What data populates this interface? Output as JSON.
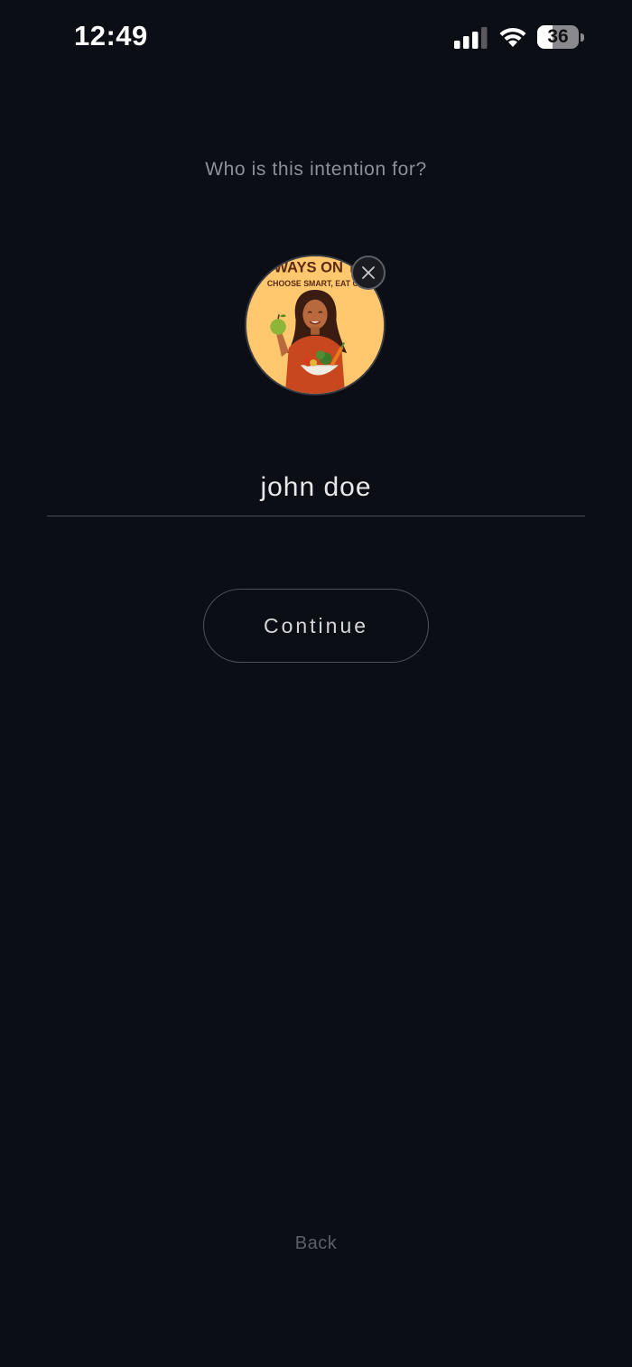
{
  "status_bar": {
    "time": "12:49",
    "battery_level": "36",
    "battery_fraction": 0.36,
    "signal_bars": 3,
    "signal_icon": "cellular-signal-icon",
    "wifi_icon": "wifi-icon",
    "battery_icon": "battery-icon"
  },
  "prompt": "Who is this intention for?",
  "avatar": {
    "poster_line1": "WAYS ON T",
    "poster_line2": "CHOOSE SMART, EAT CL",
    "remove_icon": "close-icon"
  },
  "name_field": {
    "value": "john doe"
  },
  "continue_label": "Continue",
  "back_label": "Back",
  "colors": {
    "background": "#0b0e15",
    "avatar_bg": "#ffc86e"
  }
}
